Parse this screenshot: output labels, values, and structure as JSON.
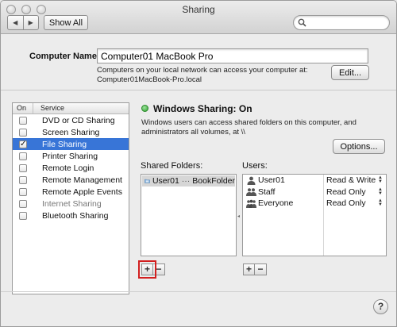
{
  "window": {
    "title": "Sharing"
  },
  "toolbar": {
    "back": "◀",
    "forward": "▶",
    "show_all": "Show All",
    "search_placeholder": "",
    "search_value": ""
  },
  "computer_name": {
    "label": "Computer Name:",
    "value": "Computer01 MacBook Pro",
    "description_line1": "Computers on your local network can access your computer at:",
    "description_line2": "Computer01MacBook-Pro.local",
    "edit_label": "Edit..."
  },
  "services": {
    "header_on": "On",
    "header_service": "Service",
    "items": [
      {
        "label": "DVD or CD Sharing",
        "checked": false,
        "selected": false,
        "dim": false
      },
      {
        "label": "Screen Sharing",
        "checked": false,
        "selected": false,
        "dim": false
      },
      {
        "label": "File Sharing",
        "checked": true,
        "selected": true,
        "dim": false
      },
      {
        "label": "Printer Sharing",
        "checked": false,
        "selected": false,
        "dim": false
      },
      {
        "label": "Remote Login",
        "checked": false,
        "selected": false,
        "dim": false
      },
      {
        "label": "Remote Management",
        "checked": false,
        "selected": false,
        "dim": false
      },
      {
        "label": "Remote Apple Events",
        "checked": false,
        "selected": false,
        "dim": false
      },
      {
        "label": "Internet Sharing",
        "checked": false,
        "selected": false,
        "dim": true
      },
      {
        "label": "Bluetooth Sharing",
        "checked": false,
        "selected": false,
        "dim": false
      }
    ]
  },
  "status": {
    "title": "Windows Sharing: On",
    "desc_line1": "Windows users can access shared folders on this computer, and",
    "desc_line2": "administrators all volumes, at \\\\",
    "options_label": "Options...",
    "color": "#2fa12f"
  },
  "shared_folders": {
    "label": "Shared Folders:",
    "items": [
      {
        "owner": "User01",
        "ellipsis": "···",
        "name": "BookFolder"
      }
    ]
  },
  "users": {
    "label": "Users:",
    "items": [
      {
        "name": "User01",
        "permission": "Read & Write",
        "icon": "user-icon"
      },
      {
        "name": "Staff",
        "permission": "Read Only",
        "icon": "group-icon"
      },
      {
        "name": "Everyone",
        "permission": "Read Only",
        "icon": "everyone-icon"
      }
    ]
  },
  "buttons": {
    "add": "+",
    "remove": "−",
    "help": "?"
  },
  "accent_color": "#3875d7",
  "highlight_color": "#d21f1f"
}
